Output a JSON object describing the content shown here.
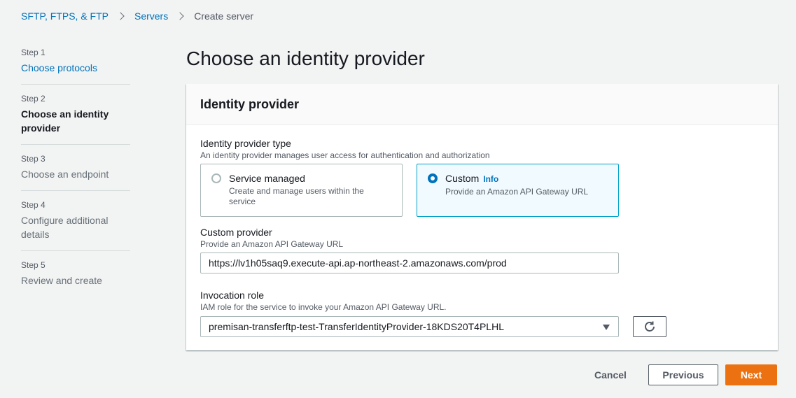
{
  "breadcrumb": {
    "item1": "SFTP, FTPS, & FTP",
    "item2": "Servers",
    "current": "Create server"
  },
  "steps": [
    {
      "num": "Step 1",
      "label": "Choose protocols"
    },
    {
      "num": "Step 2",
      "label": "Choose an identity provider"
    },
    {
      "num": "Step 3",
      "label": "Choose an endpoint"
    },
    {
      "num": "Step 4",
      "label": "Configure additional details"
    },
    {
      "num": "Step 5",
      "label": "Review and create"
    }
  ],
  "page_title": "Choose an identity provider",
  "card": {
    "header": "Identity provider",
    "idp_type": {
      "label": "Identity provider type",
      "desc": "An identity provider manages user access for authentication and authorization",
      "options": [
        {
          "title": "Service managed",
          "desc": "Create and manage users within the service",
          "selected": false
        },
        {
          "title": "Custom",
          "info": "Info",
          "desc": "Provide an Amazon API Gateway URL",
          "selected": true
        }
      ]
    },
    "custom_provider": {
      "label": "Custom provider",
      "desc": "Provide an Amazon API Gateway URL",
      "value": "https://lv1h05saq9.execute-api.ap-northeast-2.amazonaws.com/prod"
    },
    "invocation_role": {
      "label": "Invocation role",
      "desc": "IAM role for the service to invoke your Amazon API Gateway URL.",
      "value": "premisan-transferftp-test-TransferIdentityProvider-18KDS20T4PLHL"
    }
  },
  "footer": {
    "cancel": "Cancel",
    "previous": "Previous",
    "next": "Next"
  },
  "colors": {
    "link": "#0073bb",
    "primary": "#ec7211",
    "selected_tile_bg": "#f1faff",
    "selected_tile_border": "#00a1c9"
  }
}
